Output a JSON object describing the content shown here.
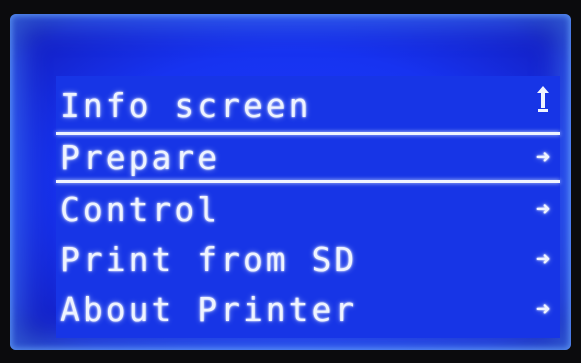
{
  "menu": {
    "items": [
      {
        "label": "Info screen",
        "icon": "back-up-arrow-icon",
        "glyph": ""
      },
      {
        "label": "Prepare",
        "icon": "right-arrow-icon",
        "glyph": "➜"
      },
      {
        "label": "Control",
        "icon": "right-arrow-icon",
        "glyph": "➜"
      },
      {
        "label": "Print from SD",
        "icon": "right-arrow-icon",
        "glyph": "➜"
      },
      {
        "label": "About Printer",
        "icon": "right-arrow-icon",
        "glyph": "➜"
      }
    ],
    "selected_index": 1
  },
  "colors": {
    "lcd_background": "#1735e6",
    "lcd_text": "#eef3ff",
    "bezel": "#0b0b0d"
  }
}
